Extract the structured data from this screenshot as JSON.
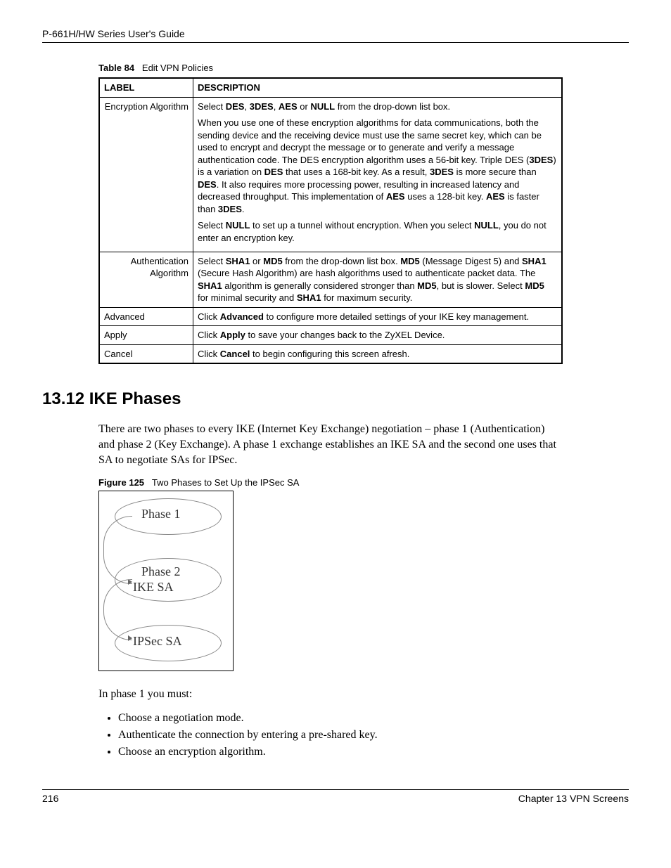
{
  "header": {
    "title": "P-661H/HW Series User's Guide"
  },
  "tableCaption": {
    "label": "Table 84",
    "title": "Edit VPN Policies"
  },
  "tableHeaders": {
    "col1": "LABEL",
    "col2": "DESCRIPTION"
  },
  "rows": {
    "encryption": {
      "label": "Encryption Algorithm",
      "p1_pre": "Select ",
      "p1_b1": "DES",
      "p1_mid1": ", ",
      "p1_b2": "3DES",
      "p1_mid2": ", ",
      "p1_b3": "AES",
      "p1_mid3": " or ",
      "p1_b4": "NULL",
      "p1_post": " from the drop-down list box.",
      "p2_a": "When you use one of these encryption algorithms for data communications, both the sending device and the receiving device must use the same secret key, which can be used to encrypt and decrypt the message or to generate and verify a message authentication code. The DES encryption algorithm uses a 56-bit key. Triple DES (",
      "p2_b1": "3DES",
      "p2_b": ") is a variation on ",
      "p2_b2": "DES",
      "p2_c": " that uses a 168-bit key. As a result, ",
      "p2_b3": "3DES",
      "p2_d": " is more secure than ",
      "p2_b4": "DES",
      "p2_e": ". It also requires more processing power, resulting in increased latency and decreased throughput. This implementation of ",
      "p2_b5": "AES",
      "p2_f": " uses a 128-bit key. ",
      "p2_b6": "AES",
      "p2_g": " is faster than ",
      "p2_b7": "3DES",
      "p2_h": ".",
      "p3_a": "Select ",
      "p3_b1": "NULL",
      "p3_b": " to set up a tunnel without encryption. When you select ",
      "p3_b2": "NULL",
      "p3_c": ", you do not enter an encryption key."
    },
    "auth": {
      "label": "Authentication Algorithm",
      "a": "Select ",
      "b1": "SHA1",
      "b": " or ",
      "b2": "MD5",
      "c": " from the drop-down list box. ",
      "b3": "MD5",
      "d": " (Message Digest 5) and ",
      "b4": "SHA1",
      "e": " (Secure Hash Algorithm) are hash algorithms used to authenticate packet data. The ",
      "b5": "SHA1",
      "f": " algorithm is generally considered stronger than ",
      "b6": "MD5",
      "g": ", but is slower. Select ",
      "b7": "MD5",
      "h": " for minimal security and ",
      "b8": "SHA1",
      "i": " for maximum security."
    },
    "advanced": {
      "label": "Advanced",
      "a": "Click ",
      "b1": "Advanced",
      "b": " to configure more detailed settings of your IKE key management."
    },
    "apply": {
      "label": "Apply",
      "a": "Click ",
      "b1": "Apply",
      "b": " to save your changes back to the ZyXEL Device."
    },
    "cancel": {
      "label": "Cancel",
      "a": "Click ",
      "b1": "Cancel",
      "b": " to begin configuring this screen afresh."
    }
  },
  "section": {
    "heading": "13.12  IKE Phases"
  },
  "intro": "There are two phases to every IKE (Internet Key Exchange) negotiation – phase 1 (Authentication) and phase 2 (Key Exchange). A phase 1 exchange establishes an IKE SA and the second one uses that SA to negotiate SAs for IPSec.",
  "figureCaption": {
    "label": "Figure 125",
    "title": "Two Phases to Set Up the IPSec SA"
  },
  "figure": {
    "t1": "Phase 1",
    "t2": "Phase 2",
    "t3": "IKE SA",
    "t4": "IPSec SA"
  },
  "listIntro": "In phase 1 you must:",
  "list": {
    "i1": "Choose a negotiation mode.",
    "i2": "Authenticate the connection by entering a pre-shared key.",
    "i3": "Choose an encryption algorithm."
  },
  "footer": {
    "page": "216",
    "chapter": "Chapter 13 VPN Screens"
  }
}
